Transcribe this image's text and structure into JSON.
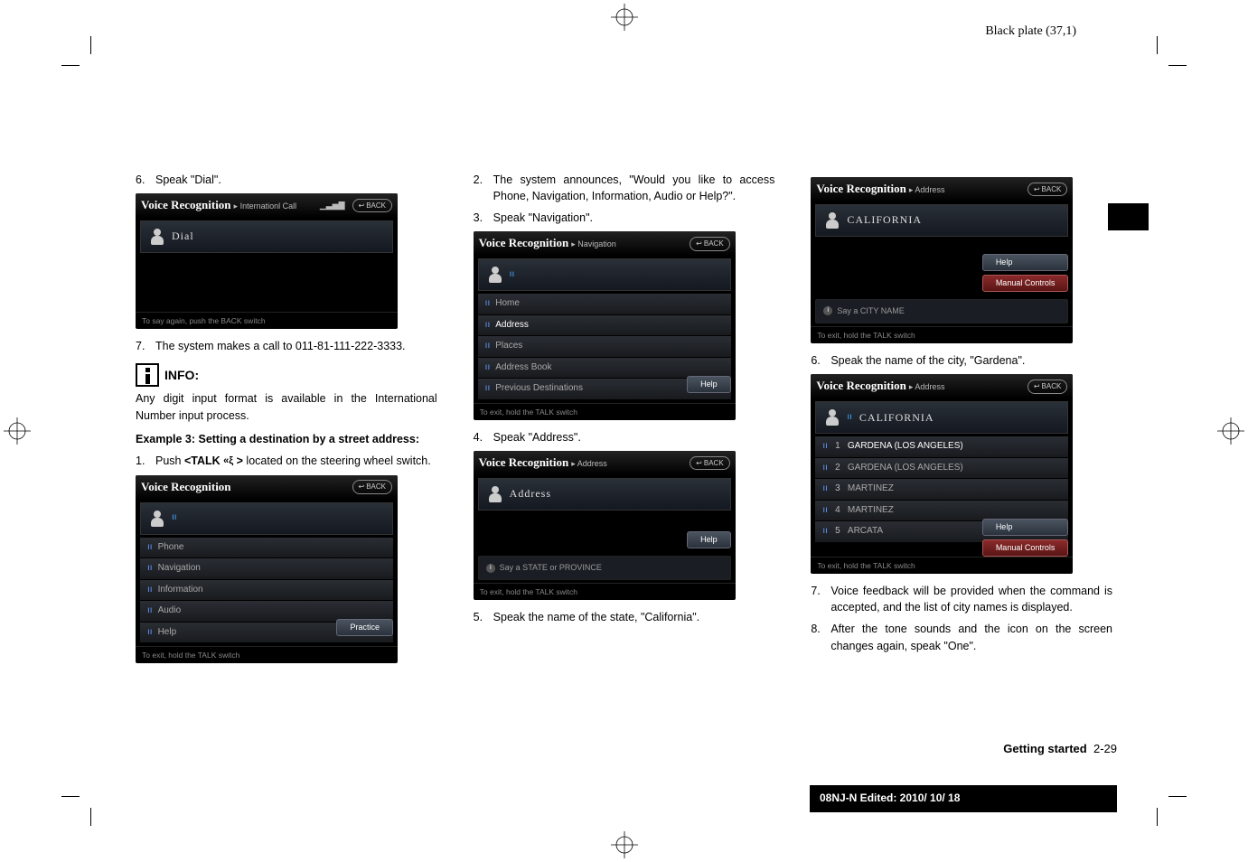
{
  "meta": {
    "plate": "Black plate (37,1)",
    "footer_section": "Getting started",
    "footer_page": "2-29",
    "edition": "08NJ-N Edited:  2010/ 10/ 18"
  },
  "col1": {
    "step6": "Speak \"Dial\".",
    "shot1": {
      "crumb": "Internationl Call",
      "back": "BACK",
      "input": "Dial",
      "footer": "To say again, push the BACK switch"
    },
    "step7": "The system makes a call to 011-81-111-222-3333.",
    "info_label": "INFO:",
    "info_text": "Any digit input format is available in the International Number input process.",
    "example_heading": "Example 3: Setting a destination by a street address:",
    "step1_a": "Push ",
    "step1_b": "<TALK ",
    "step1_c": " >",
    "step1_d": " located on the steering wheel switch.",
    "shot2": {
      "crumb": "",
      "back": "BACK",
      "rows": [
        "Phone",
        "Navigation",
        "Information",
        "Audio",
        "Help"
      ],
      "btn": "Practice",
      "footer": "To exit, hold the TALK switch"
    }
  },
  "col2": {
    "step2": "The system announces, \"Would you like to access Phone, Navigation, Information, Audio or Help?\".",
    "step3": "Speak \"Navigation\".",
    "shot3": {
      "crumb": "Navigation",
      "back": "BACK",
      "rows": [
        "Home",
        "Address",
        "Places",
        "Address Book",
        "Previous Destinations"
      ],
      "btn": "Help",
      "footer": "To exit, hold the TALK switch"
    },
    "step4": "Speak \"Address\".",
    "shot4": {
      "crumb": "Address",
      "back": "BACK",
      "input": "Address",
      "btn": "Help",
      "hint": "Say a STATE or PROVINCE",
      "footer": "To exit, hold the TALK switch"
    },
    "step5": "Speak the name of the state, \"California\"."
  },
  "col3": {
    "shot5": {
      "crumb": "Address",
      "back": "BACK",
      "input": "CALIFORNIA",
      "btn1": "Help",
      "btn2": "Manual Controls",
      "hint": "Say a CITY NAME",
      "footer": "To exit, hold the TALK switch"
    },
    "step6c": "Speak the name of the city, \"Gardena\".",
    "shot6": {
      "crumb": "Address",
      "back": "BACK",
      "input": "CALIFORNIA",
      "rows": [
        "GARDENA (LOS ANGELES)",
        "GARDENA (LOS ANGELES)",
        "MARTINEZ",
        "MARTINEZ",
        "ARCATA"
      ],
      "btn1": "Help",
      "btn2": "Manual Controls",
      "footer": "To exit, hold the TALK switch"
    },
    "step7c": "Voice feedback will be provided when the command is accepted, and the list of city names is displayed.",
    "step8c": "After the tone sounds and the icon on the screen changes again, speak \"One\"."
  },
  "vr_title": "Voice Recognition"
}
